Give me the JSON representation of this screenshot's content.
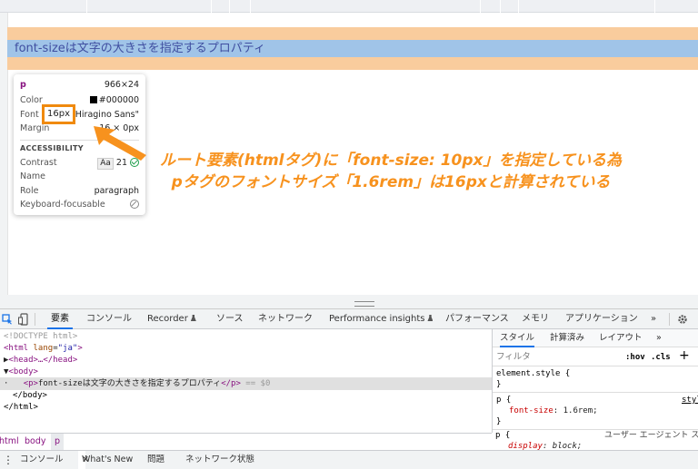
{
  "page": {
    "paragraph_text": "font-sizeは文字の大きさを指定するプロパティ"
  },
  "tooltip": {
    "tag": "p",
    "size": "966×24",
    "color_label": "Color",
    "color_value": "#000000",
    "font_label": "Font",
    "font_value": "16px \"Hiragino Sans\"",
    "margin_label": "Margin",
    "margin_value": "16 × 0px",
    "accessibility_heading": "ACCESSIBILITY",
    "contrast_label": "Contrast",
    "contrast_aa": "Aa",
    "contrast_value": "21",
    "name_label": "Name",
    "role_label": "Role",
    "role_value": "paragraph",
    "focusable_label": "Keyboard-focusable"
  },
  "annotation": {
    "box_text": "16px",
    "line1": "ルート要素(htmlタグ)に「font-size: 10px」を指定している為",
    "line2": "pタグのフォントサイズ「1.6rem」は16pxと計算されている",
    "color": "#f7921e"
  },
  "devtools_tabs": {
    "elements": "要素",
    "console": "コンソール",
    "recorder": "Recorder",
    "sources": "ソース",
    "network": "ネットワーク",
    "performance_insights": "Performance insights",
    "performance": "パフォーマンス",
    "memory": "メモリ",
    "application": "アプリケーション",
    "more": "»"
  },
  "dom": {
    "doctype": "<!DOCTYPE html>",
    "html_open_tag": "<html",
    "html_lang_attr": "lang",
    "html_lang_value": "\"ja\"",
    "head_collapsed": "<head>…</head>",
    "body_open": "<body>",
    "p_open": "<p>",
    "p_text": "font-sizeは文字の大きさを指定するプロパティ",
    "p_close": "</p>",
    "selected_marker": "== $0",
    "body_close": "</body>",
    "html_close": "</html>"
  },
  "styles_pane": {
    "tab_styles": "スタイル",
    "tab_computed": "計算済み",
    "tab_layout": "レイアウト",
    "tab_more": "»",
    "filter_placeholder": "フィルタ",
    "hov": ":hov",
    "cls": ".cls",
    "add": "+",
    "rule1_selector": "element.style {",
    "rule1_close": "}",
    "rule2_selector": "p {",
    "rule2_source": "style",
    "rule2_prop": "font-size",
    "rule2_value": "1.6rem;",
    "rule2_close": "}",
    "rule3_selector": "p {",
    "rule3_source": "ユーザー エージェント スタ",
    "rule3_prop": "display",
    "rule3_value": "block;"
  },
  "breadcrumb": [
    "html",
    "body",
    "p"
  ],
  "drawer_tabs": {
    "console": "コンソール",
    "whats_new": "What's New",
    "close": "×",
    "issues": "問題",
    "network_conditions": "ネットワーク状態"
  }
}
